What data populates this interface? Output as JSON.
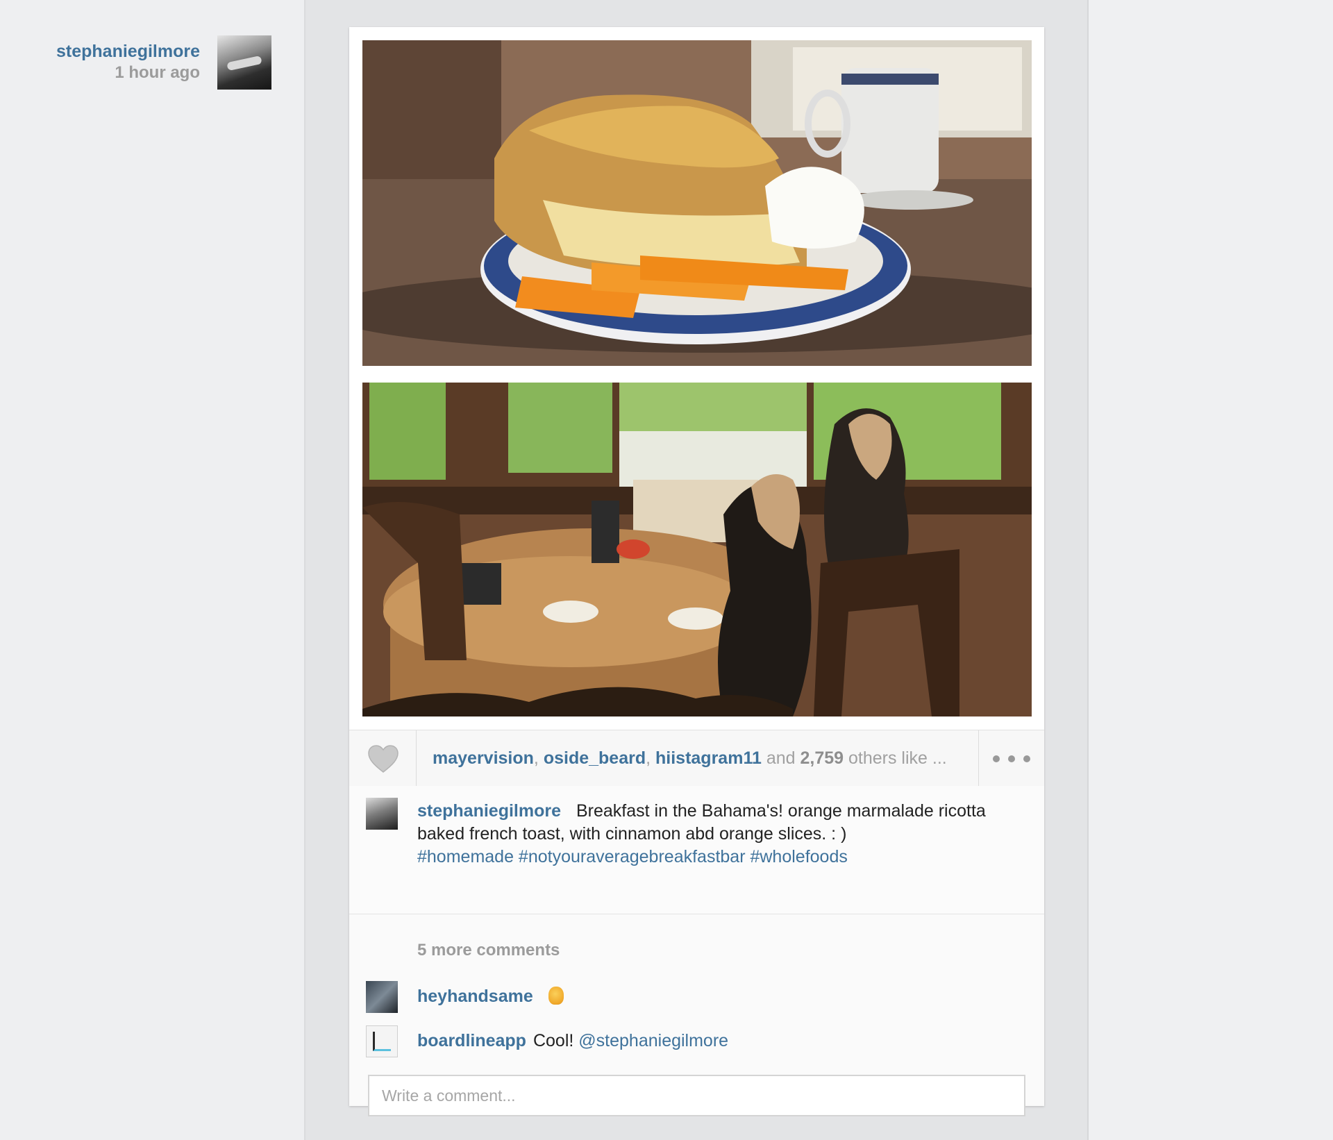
{
  "poster": {
    "username": "stephaniegilmore",
    "time_ago": "1 hour ago"
  },
  "likes": {
    "users": [
      "mayervision",
      "oside_beard",
      "hiistagram11"
    ],
    "sep1": ", ",
    "sep2": ", ",
    "and_text": " and ",
    "count": "2,759",
    "others_text": " others like ..."
  },
  "caption": {
    "username": "stephaniegilmore",
    "text": "Breakfast in the Bahama's! orange marmalade ricotta baked french toast, with cinnamon abd orange slices. : )",
    "hashtags": "#homemade #notyouraveragebreakfastbar #wholefoods"
  },
  "comments": {
    "more_label": "5 more comments",
    "items": [
      {
        "username": "heyhandsame",
        "text": "",
        "mention": "",
        "emoji": "ok-hand-emoji"
      },
      {
        "username": "boardlineapp",
        "text": "Cool!",
        "mention": "@stephaniegilmore"
      }
    ],
    "input_placeholder": "Write a comment..."
  },
  "colors": {
    "link": "#3f729b",
    "muted": "#9b9b9b"
  },
  "icons": [
    "heart-icon",
    "more-options-icon",
    "ok-hand-emoji"
  ]
}
